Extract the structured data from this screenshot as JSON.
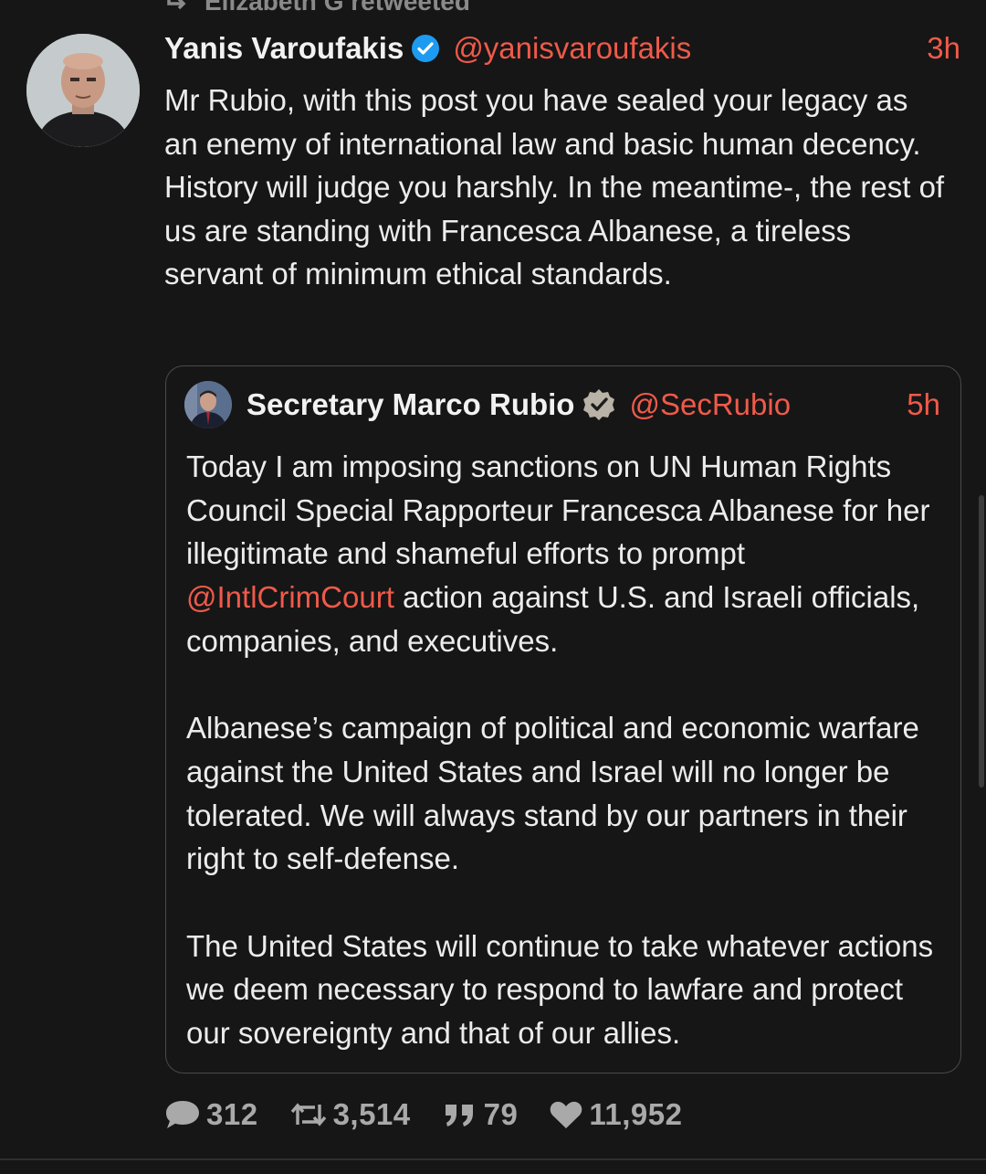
{
  "retweet_label": "Elizabeth G retweeted",
  "tweet": {
    "author_name": "Yanis Varoufakis",
    "handle": "@yanisvaroufakis",
    "time": "3h",
    "text": "Mr Rubio, with this post you have sealed your legacy as an enemy of international law and basic human decency.  History will judge you harshly. In the meantime-, the rest of us are standing with Francesca Albanese, a tireless servant of minimum ethical standards."
  },
  "quote": {
    "author_name": "Secretary Marco Rubio",
    "handle": "@SecRubio",
    "time": "5h",
    "p1_before": "Today I am imposing sanctions on UN Human Rights Council Special Rapporteur Francesca Albanese for her illegitimate and shameful efforts to prompt ",
    "p1_mention": "@IntlCrimCourt",
    "p1_after": " action against U.S. and Israeli officials, companies, and executives.",
    "p2": "Albanese’s campaign of political and economic warfare against the United States and Israel will no longer be tolerated. We will always stand by our partners in their right to self-defense.",
    "p3": "The United States will continue to take whatever actions we deem necessary to respond to lawfare and protect our sovereignty and that of our allies."
  },
  "stats": {
    "replies": "312",
    "reposts": "3,514",
    "quotes": "79",
    "likes": "11,952"
  },
  "colors": {
    "background": "#161616",
    "accent": "#ef5a4a",
    "verified_blue": "#1d9bf0",
    "verified_gray": "#b9b2a6"
  }
}
